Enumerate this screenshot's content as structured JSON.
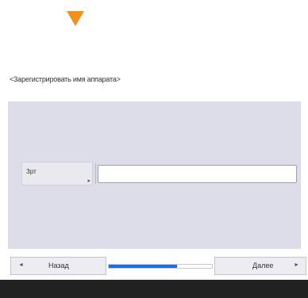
{
  "screen": {
    "title": "<Зарегистрировать имя аппарата>"
  },
  "form": {
    "field_label": "Зрт",
    "field_marker": "▸",
    "input_value": "",
    "input_placeholder": ""
  },
  "nav": {
    "back_label": "Назад",
    "back_arrow": "◄",
    "next_label": "Далее",
    "next_arrow": "►"
  },
  "progress": {
    "value": 0.66
  },
  "colors": {
    "accent_arrow": "#f0901e",
    "progress_fill": "#1f6fd8",
    "panel_bg": "#dcdde8"
  },
  "icons": {
    "indicator": "down-triangle-icon",
    "back": "left-triangle-icon",
    "next": "right-triangle-icon"
  }
}
